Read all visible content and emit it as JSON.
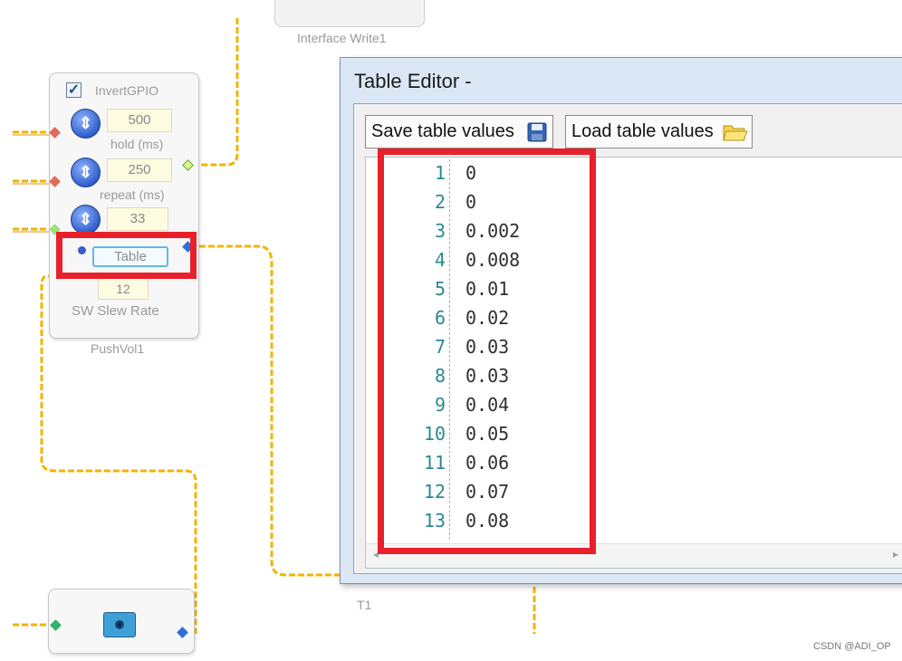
{
  "canvas": {
    "interface_block": {
      "caption": "Interface Write1"
    },
    "pushvol_block": {
      "checkbox_label": "InvertGPIO",
      "hold_value": "500",
      "hold_label": "hold (ms)",
      "repeat_value": "250",
      "repeat_label": "repeat (ms)",
      "third_value": "33",
      "table_button_label": "Table",
      "slew_value": "12",
      "slew_label": "SW Slew Rate",
      "caption": "PushVol1"
    },
    "lower_block_caption": "T1"
  },
  "dialog": {
    "title": "Table Editor -",
    "save_button_label": "Save table values",
    "load_button_label": "Load table values",
    "rows": [
      {
        "n": "1",
        "v": "0"
      },
      {
        "n": "2",
        "v": "0"
      },
      {
        "n": "3",
        "v": "0.002"
      },
      {
        "n": "4",
        "v": "0.008"
      },
      {
        "n": "5",
        "v": "0.01"
      },
      {
        "n": "6",
        "v": "0.02"
      },
      {
        "n": "7",
        "v": "0.03"
      },
      {
        "n": "8",
        "v": "0.03"
      },
      {
        "n": "9",
        "v": "0.04"
      },
      {
        "n": "10",
        "v": "0.05"
      },
      {
        "n": "11",
        "v": "0.06"
      },
      {
        "n": "12",
        "v": "0.07"
      },
      {
        "n": "13",
        "v": "0.08"
      }
    ]
  },
  "colors": {
    "wire": "#f2b300",
    "highlight": "#e8202a",
    "accent_pin": "#2eb36b"
  },
  "watermark": "CSDN @ADI_OP"
}
